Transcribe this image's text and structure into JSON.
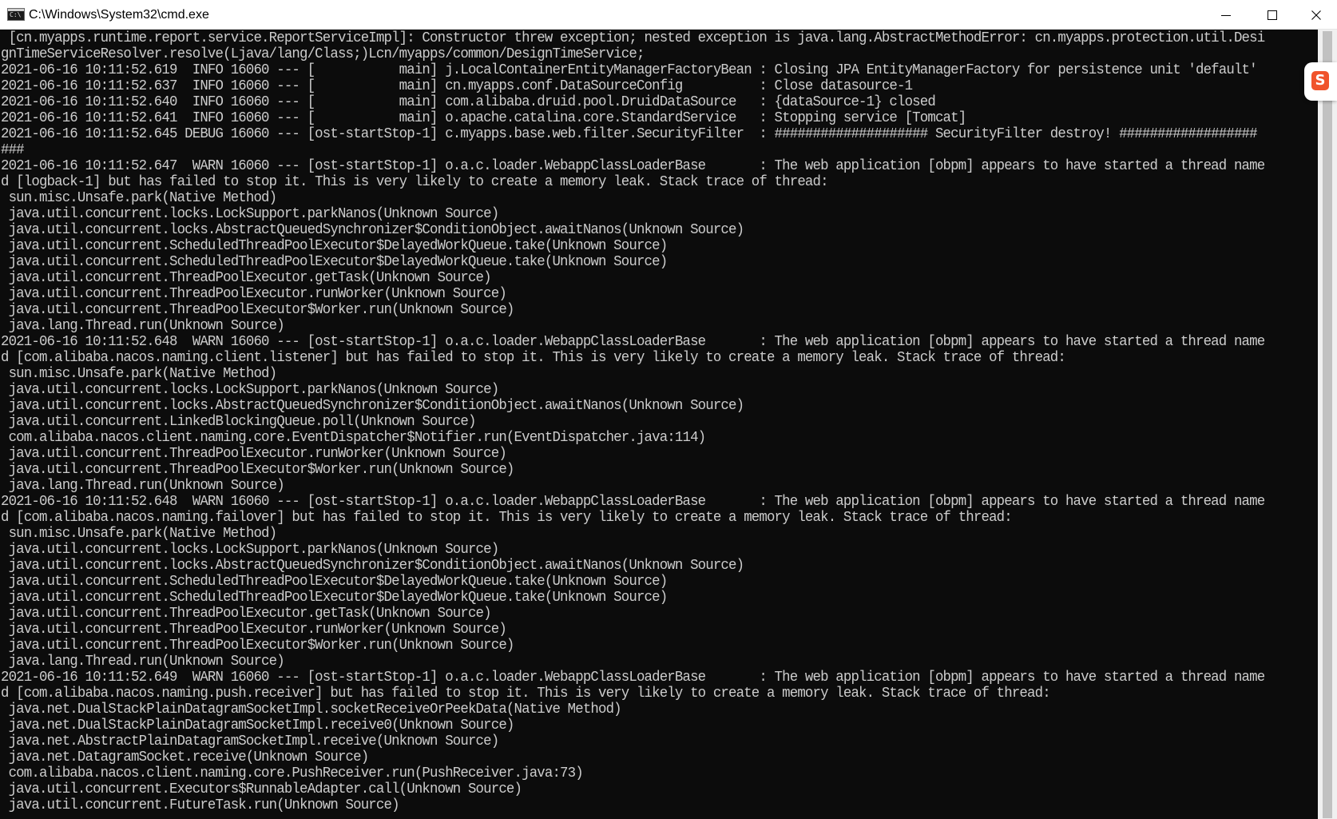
{
  "window": {
    "title": "C:\\Windows\\System32\\cmd.exe",
    "app_icon_text": "C:\\",
    "controls": {
      "minimize": "minimize",
      "maximize": "maximize",
      "close": "close"
    }
  },
  "ime_badge": {
    "label": "S",
    "color": "#f0532b"
  },
  "colors": {
    "console_background": "#0c0c0c",
    "console_text": "#cccccc"
  },
  "console": {
    "lines": [
      " [cn.myapps.runtime.report.service.ReportServiceImpl]: Constructor threw exception; nested exception is java.lang.AbstractMethodError: cn.myapps.protection.util.Desi",
      "gnTimeServiceResolver.resolve(Ljava/lang/Class;)Lcn/myapps/common/DesignTimeService;",
      "2021-06-16 10:11:52.619  INFO 16060 --- [           main] j.LocalContainerEntityManagerFactoryBean : Closing JPA EntityManagerFactory for persistence unit 'default'",
      "2021-06-16 10:11:52.637  INFO 16060 --- [           main] cn.myapps.conf.DataSourceConfig          : Close datasource-1",
      "2021-06-16 10:11:52.640  INFO 16060 --- [           main] com.alibaba.druid.pool.DruidDataSource   : {dataSource-1} closed",
      "2021-06-16 10:11:52.641  INFO 16060 --- [           main] o.apache.catalina.core.StandardService   : Stopping service [Tomcat]",
      "2021-06-16 10:11:52.645 DEBUG 16060 --- [ost-startStop-1] c.myapps.base.web.filter.SecurityFilter  : #################### SecurityFilter destroy! ##################",
      "###",
      "2021-06-16 10:11:52.647  WARN 16060 --- [ost-startStop-1] o.a.c.loader.WebappClassLoaderBase       : The web application [obpm] appears to have started a thread name",
      "d [logback-1] but has failed to stop it. This is very likely to create a memory leak. Stack trace of thread:",
      " sun.misc.Unsafe.park(Native Method)",
      " java.util.concurrent.locks.LockSupport.parkNanos(Unknown Source)",
      " java.util.concurrent.locks.AbstractQueuedSynchronizer$ConditionObject.awaitNanos(Unknown Source)",
      " java.util.concurrent.ScheduledThreadPoolExecutor$DelayedWorkQueue.take(Unknown Source)",
      " java.util.concurrent.ScheduledThreadPoolExecutor$DelayedWorkQueue.take(Unknown Source)",
      " java.util.concurrent.ThreadPoolExecutor.getTask(Unknown Source)",
      " java.util.concurrent.ThreadPoolExecutor.runWorker(Unknown Source)",
      " java.util.concurrent.ThreadPoolExecutor$Worker.run(Unknown Source)",
      " java.lang.Thread.run(Unknown Source)",
      "2021-06-16 10:11:52.648  WARN 16060 --- [ost-startStop-1] o.a.c.loader.WebappClassLoaderBase       : The web application [obpm] appears to have started a thread name",
      "d [com.alibaba.nacos.naming.client.listener] but has failed to stop it. This is very likely to create a memory leak. Stack trace of thread:",
      " sun.misc.Unsafe.park(Native Method)",
      " java.util.concurrent.locks.LockSupport.parkNanos(Unknown Source)",
      " java.util.concurrent.locks.AbstractQueuedSynchronizer$ConditionObject.awaitNanos(Unknown Source)",
      " java.util.concurrent.LinkedBlockingQueue.poll(Unknown Source)",
      " com.alibaba.nacos.client.naming.core.EventDispatcher$Notifier.run(EventDispatcher.java:114)",
      " java.util.concurrent.ThreadPoolExecutor.runWorker(Unknown Source)",
      " java.util.concurrent.ThreadPoolExecutor$Worker.run(Unknown Source)",
      " java.lang.Thread.run(Unknown Source)",
      "2021-06-16 10:11:52.648  WARN 16060 --- [ost-startStop-1] o.a.c.loader.WebappClassLoaderBase       : The web application [obpm] appears to have started a thread name",
      "d [com.alibaba.nacos.naming.failover] but has failed to stop it. This is very likely to create a memory leak. Stack trace of thread:",
      " sun.misc.Unsafe.park(Native Method)",
      " java.util.concurrent.locks.LockSupport.parkNanos(Unknown Source)",
      " java.util.concurrent.locks.AbstractQueuedSynchronizer$ConditionObject.awaitNanos(Unknown Source)",
      " java.util.concurrent.ScheduledThreadPoolExecutor$DelayedWorkQueue.take(Unknown Source)",
      " java.util.concurrent.ScheduledThreadPoolExecutor$DelayedWorkQueue.take(Unknown Source)",
      " java.util.concurrent.ThreadPoolExecutor.getTask(Unknown Source)",
      " java.util.concurrent.ThreadPoolExecutor.runWorker(Unknown Source)",
      " java.util.concurrent.ThreadPoolExecutor$Worker.run(Unknown Source)",
      " java.lang.Thread.run(Unknown Source)",
      "2021-06-16 10:11:52.649  WARN 16060 --- [ost-startStop-1] o.a.c.loader.WebappClassLoaderBase       : The web application [obpm] appears to have started a thread name",
      "d [com.alibaba.nacos.naming.push.receiver] but has failed to stop it. This is very likely to create a memory leak. Stack trace of thread:",
      " java.net.DualStackPlainDatagramSocketImpl.socketReceiveOrPeekData(Native Method)",
      " java.net.DualStackPlainDatagramSocketImpl.receive0(Unknown Source)",
      " java.net.AbstractPlainDatagramSocketImpl.receive(Unknown Source)",
      " java.net.DatagramSocket.receive(Unknown Source)",
      " com.alibaba.nacos.client.naming.core.PushReceiver.run(PushReceiver.java:73)",
      " java.util.concurrent.Executors$RunnableAdapter.call(Unknown Source)",
      " java.util.concurrent.FutureTask.run(Unknown Source)"
    ]
  }
}
